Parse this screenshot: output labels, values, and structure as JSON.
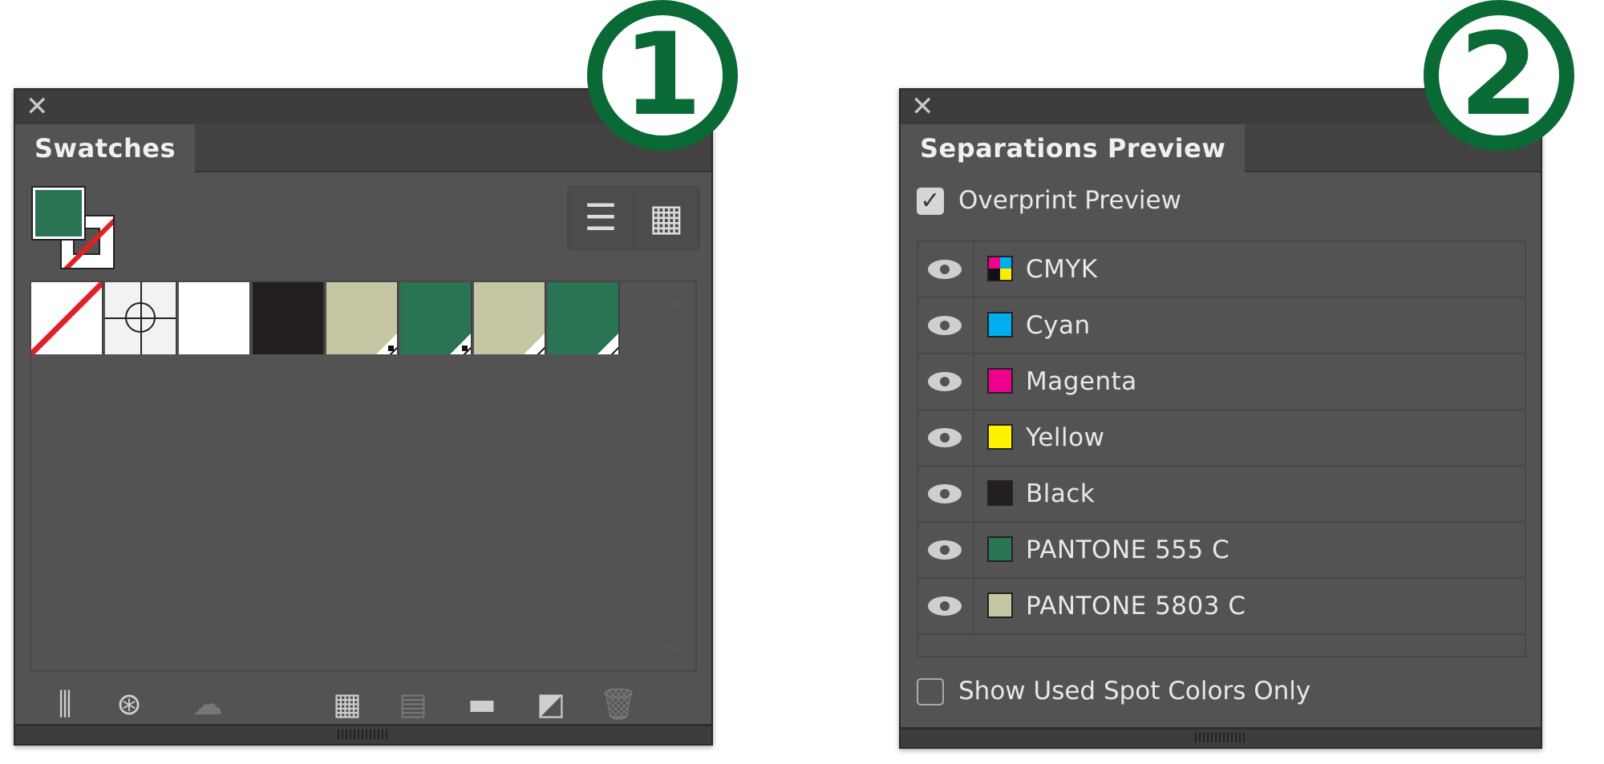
{
  "badges": {
    "one": "1",
    "two": "2"
  },
  "swatches_panel": {
    "tab": "Swatches",
    "fill_color": "#2a7353",
    "stroke": "none",
    "view_buttons": [
      "list-view-icon",
      "grid-view-icon"
    ],
    "swatches": [
      {
        "name": "[None]",
        "color": "none"
      },
      {
        "name": "[Registration]",
        "color": "registration"
      },
      {
        "name": "White",
        "color": "#ffffff"
      },
      {
        "name": "Black",
        "color": "#231f20"
      },
      {
        "name": "PANTONE 5803 C",
        "color": "#c5c6a3",
        "spot": true,
        "marker": "dot"
      },
      {
        "name": "PANTONE 555 C",
        "color": "#2a7353",
        "spot": true,
        "marker": "dot"
      },
      {
        "name": "PANTONE 5803 C",
        "color": "#c5c6a3",
        "spot": true,
        "marker": "line"
      },
      {
        "name": "PANTONE 555 C",
        "color": "#2a7353",
        "spot": true,
        "marker": "line"
      }
    ],
    "toolbar": [
      "libraries-menu-icon",
      "share-icon",
      "cloud-sync-icon",
      "swatch-kind-icon",
      "swatch-options-icon",
      "new-group-icon",
      "new-swatch-icon",
      "delete-icon"
    ]
  },
  "separations_panel": {
    "tab": "Separations Preview",
    "overprint_label": "Overprint Preview",
    "overprint_checked": true,
    "rows": [
      {
        "label": "CMYK",
        "color": "cmyk"
      },
      {
        "label": "Cyan",
        "color": "#00aeef"
      },
      {
        "label": "Magenta",
        "color": "#ec008c"
      },
      {
        "label": "Yellow",
        "color": "#fff200"
      },
      {
        "label": "Black",
        "color": "#231f20"
      },
      {
        "label": "PANTONE 555 C",
        "color": "#2a7353"
      },
      {
        "label": "PANTONE 5803 C",
        "color": "#c5c6a3"
      }
    ],
    "spot_only_label": "Show Used Spot Colors Only",
    "spot_only_checked": false
  }
}
